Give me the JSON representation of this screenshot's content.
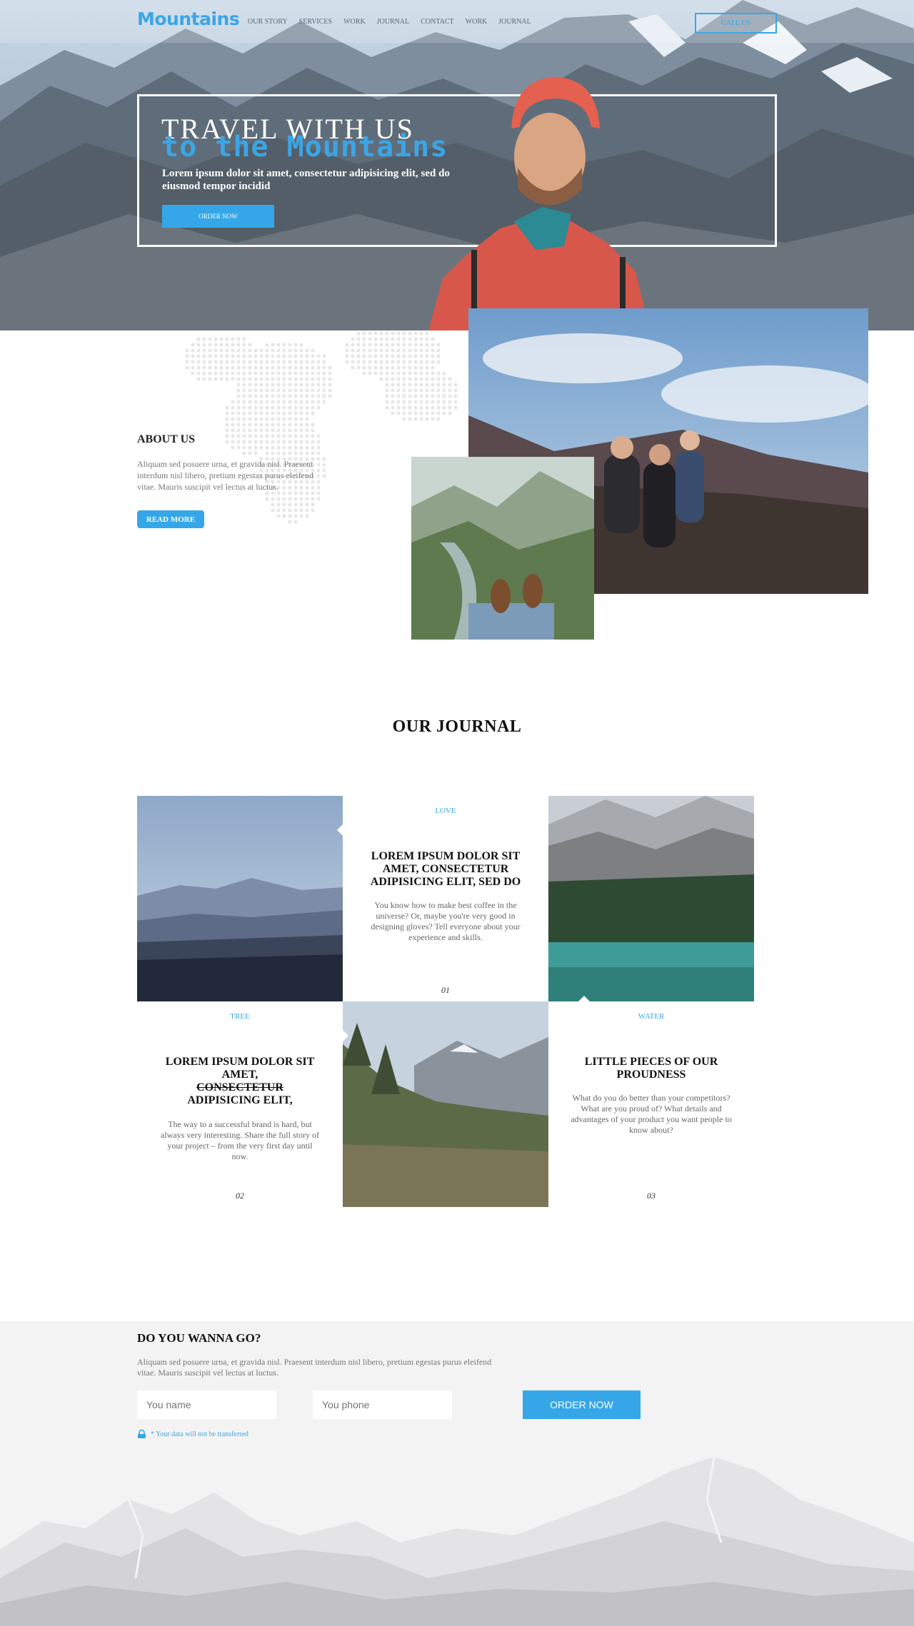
{
  "header": {
    "logo": "Mountains",
    "nav": [
      "OUR STORY",
      "SERVICES",
      "WORK",
      "JOURNAL",
      "CONTACT",
      "WORK",
      "JOURNAL"
    ],
    "call_label": "CALL US"
  },
  "hero": {
    "title_line1": "TRAVEL WITH US",
    "title_line2": "to the Mountains",
    "subtitle": "Lorem ipsum dolor sit amet, consectetur adipisicing elit, sed do eiusmod tempor incidid",
    "button": "ORDER NOW"
  },
  "about": {
    "title": "ABOUT US",
    "text": "Aliquam sed posuere urna, et gravida nisl. Praesent interdum nisl libero, pretium egestas purus eleifend vitae. Mauris suscipit vel lectus at luctus.",
    "button": "READ MORE"
  },
  "journal": {
    "title": "OUR JOURNAL",
    "cards": [
      {
        "tag": "LOVE",
        "title": "LOREM IPSUM DOLOR SIT AMET, CONSECTETUR ADIPISICING ELIT, SED DO",
        "text": "You know how to make best coffee in the universe? Or, maybe you're very good in designing gloves? Tell everyone about your experience and skills.",
        "num": "01"
      },
      {
        "tag": "TREE",
        "title_a": "LOREM IPSUM DOLOR SIT AMET,",
        "title_strike": "CONSECTETUR",
        "title_b": "ADIPISICING ELIT,",
        "text": "The way to a successful brand is hard, but always very interesting. Share the full story of your project – from the very first day until now.",
        "num": "02"
      },
      {
        "tag": "WATER",
        "title": "LITTLE PIECES OF OUR PROUDNESS",
        "text": "What do you do better than your competitors? What are you proud of? What details and advantages of your product you want people to know about?",
        "num": "03"
      }
    ]
  },
  "order": {
    "title": "DO YOU WANNA GO?",
    "text": "Aliquam sed posuere urna, et gravida nisl. Praesent interdum nisl libero, pretium egestas purus eleifend vitae. Mauris suscipit vel lectus at luctus.",
    "name_placeholder": "You name",
    "phone_placeholder": "You phone",
    "button": "ORDER NOW",
    "note": "* Your data will not be transferred"
  },
  "colors": {
    "accent": "#35a7e8",
    "text": "#222222",
    "muted": "#777777",
    "footer_bg": "#f4f3f4"
  },
  "icons": [
    "lock-icon"
  ]
}
